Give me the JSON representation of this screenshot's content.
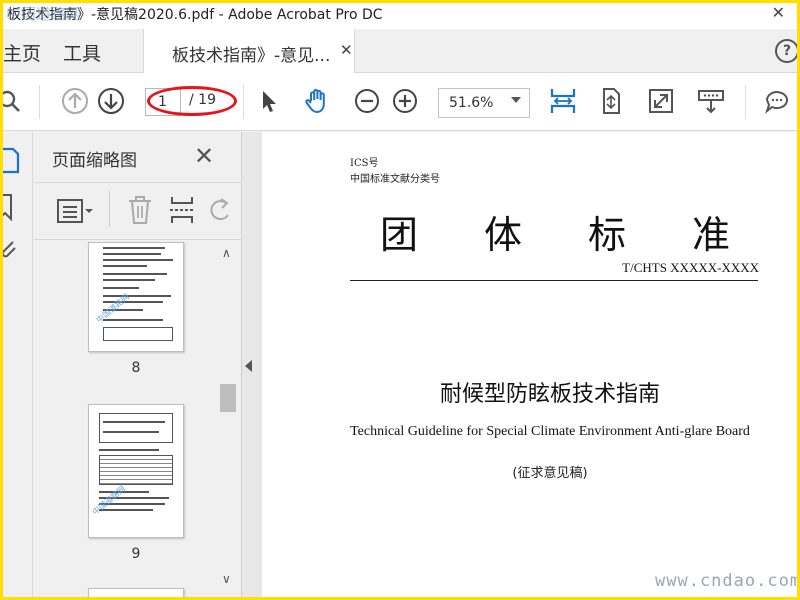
{
  "window": {
    "title": "板技术指南》-意见稿2020.6.pdf - Adobe Acrobat Pro DC"
  },
  "tabs": {
    "home": "主页",
    "tools": "工具",
    "document": "板技术指南》-意见..."
  },
  "toolbar": {
    "current_page": "1",
    "total_pages": "/ 19",
    "zoom": "51.6%"
  },
  "thumbnail_panel": {
    "title": "页面缩略图",
    "thumbnails": [
      {
        "page": "8"
      },
      {
        "page": "9"
      }
    ]
  },
  "document": {
    "ics": "ICS号",
    "classification": "中国标准文献分类号",
    "standard_type_chars": [
      "团",
      "体",
      "标",
      "准"
    ],
    "standard_number": "T/CHTS XXXXX-XXXX",
    "title_cn": "耐候型防眩板技术指南",
    "title_en": "Technical Guideline for Special Climate Environment Anti-glare Board",
    "draft_note": "(征求意见稿)"
  },
  "watermarks": {
    "top_left": "中国道路网",
    "bottom_right": "www.cndao.com"
  },
  "colors": {
    "accent_blue": "#1a73c9",
    "highlight_red": "#e8131b",
    "frame_yellow": "#ffde00"
  }
}
